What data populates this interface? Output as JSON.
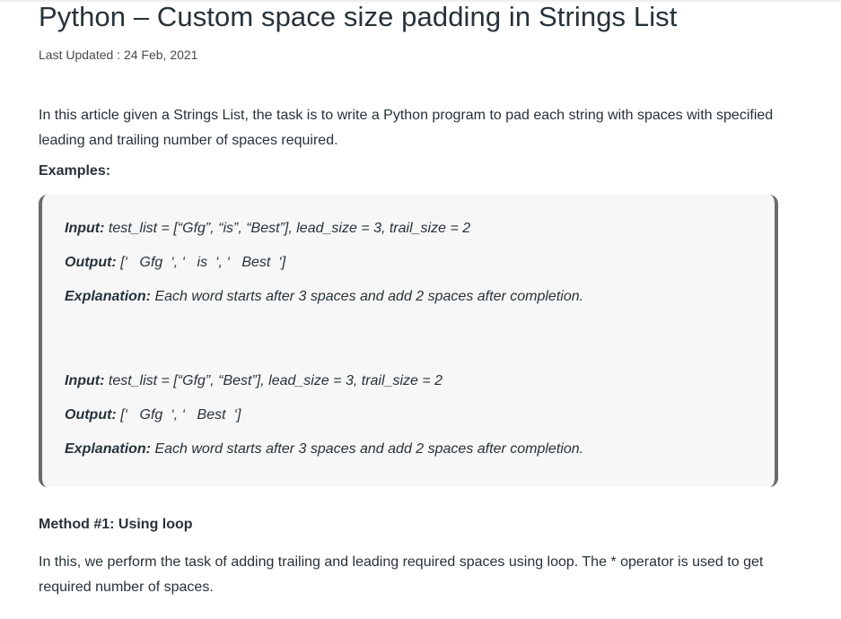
{
  "article": {
    "title": "Python – Custom space size padding in Strings List",
    "last_updated": "Last Updated : 24 Feb, 2021",
    "intro": "In this article given a Strings List, the task is to write a Python program to pad each string with spaces with specified leading and trailing number of spaces required.",
    "examples_heading": "Examples:",
    "examples": [
      {
        "input_label": "Input:",
        "input_value": " test_list = [“Gfg”, “is”, “Best”], lead_size = 3, trail_size = 2",
        "output_label": "Output:",
        "output_value": " [‘   Gfg  ‘, ‘   is  ‘, ‘   Best  ‘]",
        "explanation_label": "Explanation:",
        "explanation_value": " Each word starts after 3 spaces and add 2 spaces after completion."
      },
      {
        "input_label": "Input:",
        "input_value": " test_list = [“Gfg”, “Best”], lead_size = 3, trail_size = 2",
        "output_label": "Output:",
        "output_value": " [‘   Gfg  ‘, ‘   Best  ‘]",
        "explanation_label": "Explanation:",
        "explanation_value": " Each word starts after 3 spaces and add 2 spaces after completion."
      }
    ],
    "method_heading": "Method #1: Using loop",
    "method_text": "In this, we perform the task of adding trailing and leading required spaces using loop. The * operator is used to get required number of spaces."
  }
}
